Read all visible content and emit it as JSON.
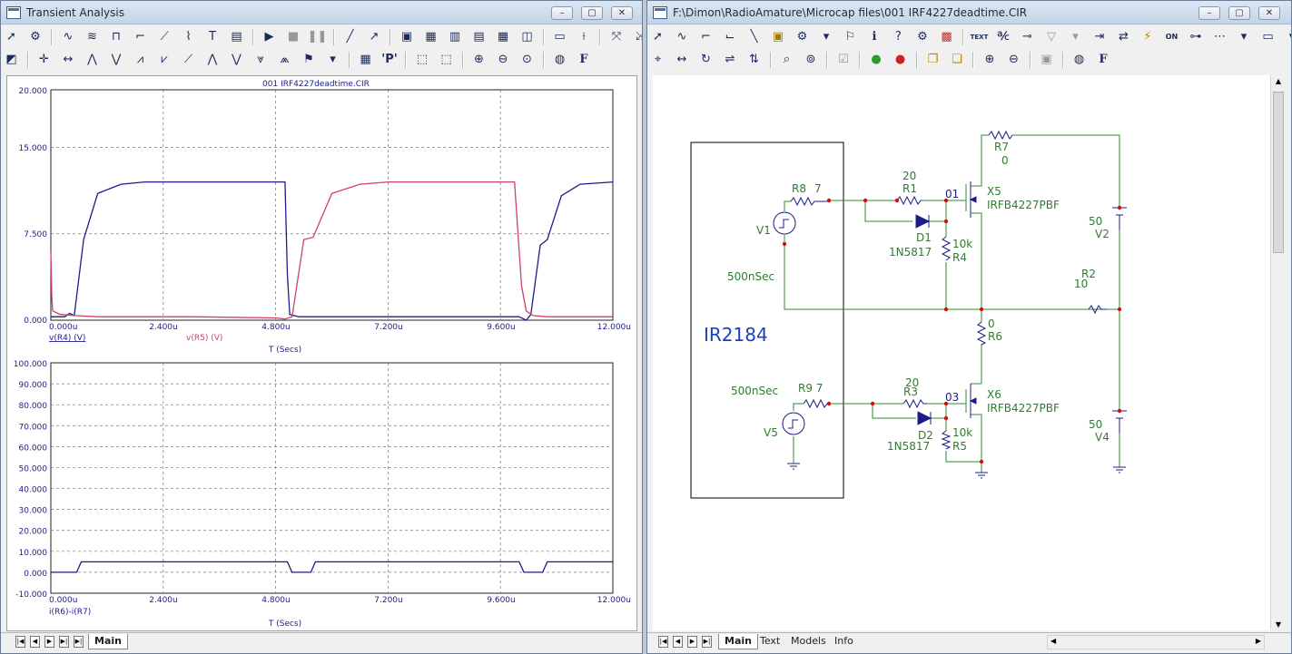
{
  "left_window": {
    "title": "Transient Analysis",
    "buttons": {
      "minimize": "–",
      "maximize": "▢",
      "close": "✕"
    },
    "tabs": [
      "Main"
    ],
    "plot1": {
      "title": "001 IRF4227deadtime.CIR",
      "ylim": [
        0,
        20
      ],
      "yticks": [
        "20.000",
        "15.000",
        "7.500",
        "0.000"
      ],
      "xticks": [
        "0.000u",
        "2.400u",
        "4.800u",
        "7.200u",
        "9.600u",
        "12.000u"
      ],
      "xlabel": "T (Secs)",
      "legend1": "v(R4) (V)",
      "legend2": "v(R5) (V)",
      "color1": "#1c1c8a",
      "color2": "#d04060"
    },
    "plot2": {
      "ylim": [
        -10,
        100
      ],
      "yticks": [
        "100.000",
        "90.000",
        "80.000",
        "70.000",
        "60.000",
        "50.000",
        "40.000",
        "30.000",
        "20.000",
        "10.000",
        "0.000",
        "-10.000"
      ],
      "xticks": [
        "0.000u",
        "2.400u",
        "4.800u",
        "7.200u",
        "9.600u",
        "12.000u"
      ],
      "xlabel": "T (Secs)",
      "legend1": "i(R6)-i(R7)",
      "color1": "#1c1c8a"
    }
  },
  "right_window": {
    "title": "F:\\Dimon\\RadioAmature\\Microcap files\\001 IRF4227deadtime.CIR",
    "buttons": {
      "minimize": "–",
      "maximize": "▢",
      "close": "✕"
    },
    "tabs": [
      "Main",
      "Text",
      "Models",
      "Info"
    ],
    "schematic": {
      "ic_label": "IR2184",
      "labels": {
        "R8": "R8",
        "R8v": "7",
        "R1v": "20",
        "R1": "R1",
        "n01": "01",
        "X5": "X5",
        "X5m": "IRFB4227PBF",
        "R7": "R7",
        "R7v": "0",
        "V1": "V1",
        "D1": "D1",
        "D1m": "1N5817",
        "R4v": "10k",
        "R4": "R4",
        "V2v": "50",
        "V2": "V2",
        "V1t": "500nSec",
        "R2": "R2",
        "R2v": "10",
        "R6v": "0",
        "R6": "R6",
        "V5t": "500nSec",
        "R9": "R9 7",
        "R3v": "20",
        "R3": "R3",
        "n03": "03",
        "X6": "X6",
        "X6m": "IRFB4227PBF",
        "V5": "V5",
        "D2": "D2",
        "D2m": "1N5817",
        "R5v": "10k",
        "R5": "R5",
        "V4v": "50",
        "V4": "V4"
      },
      "wire_color": "#2e8b2e",
      "text_color": "#2e7d2e",
      "part_color": "#1c1c8a",
      "node_color": "#d01010"
    }
  },
  "chart_data": [
    {
      "type": "line",
      "title": "001 IRF4227deadtime.CIR",
      "xlabel": "T (Secs)",
      "ylabel": "",
      "xlim": [
        0,
        12
      ],
      "ylim": [
        0,
        20
      ],
      "series": [
        {
          "name": "v(R4) (V)",
          "x": [
            0,
            0.3,
            0.4,
            0.5,
            0.7,
            1.0,
            1.5,
            2.0,
            3.0,
            4.8,
            5.0,
            5.05,
            5.1,
            5.3,
            6.0,
            8.0,
            9.6,
            10.0,
            10.15,
            10.25,
            10.45,
            10.6,
            10.9,
            11.3,
            12.0
          ],
          "y": [
            0.3,
            0.3,
            0.6,
            0.4,
            7.0,
            11.0,
            11.8,
            12.0,
            12.0,
            12.0,
            12.0,
            4.0,
            0.5,
            0.3,
            0.3,
            0.3,
            0.3,
            0.3,
            0.0,
            0.5,
            6.5,
            7.0,
            10.8,
            11.8,
            12.0
          ]
        },
        {
          "name": "v(R5) (V)",
          "x": [
            0,
            0.02,
            0.04,
            0.2,
            0.5,
            1.0,
            3.0,
            4.8,
            5.0,
            5.15,
            5.4,
            5.6,
            6.0,
            6.6,
            7.2,
            9.6,
            9.9,
            10.05,
            10.15,
            10.3,
            10.6,
            12.0
          ],
          "y": [
            6.0,
            2.0,
            0.8,
            0.5,
            0.4,
            0.3,
            0.3,
            0.2,
            0.1,
            0.3,
            7.0,
            7.2,
            11.0,
            11.8,
            12.0,
            12.0,
            12.0,
            3.0,
            0.8,
            0.4,
            0.3,
            0.3
          ]
        }
      ]
    },
    {
      "type": "line",
      "xlabel": "T (Secs)",
      "ylabel": "",
      "xlim": [
        0,
        12
      ],
      "ylim": [
        -10,
        100
      ],
      "series": [
        {
          "name": "i(R6)-i(R7)",
          "x": [
            0,
            0.55,
            0.65,
            5.05,
            5.15,
            5.55,
            5.65,
            10.0,
            10.1,
            10.5,
            10.6,
            12.0
          ],
          "y": [
            0,
            0,
            5,
            5,
            0,
            0,
            5,
            5,
            0,
            0,
            5,
            5
          ]
        }
      ]
    }
  ]
}
